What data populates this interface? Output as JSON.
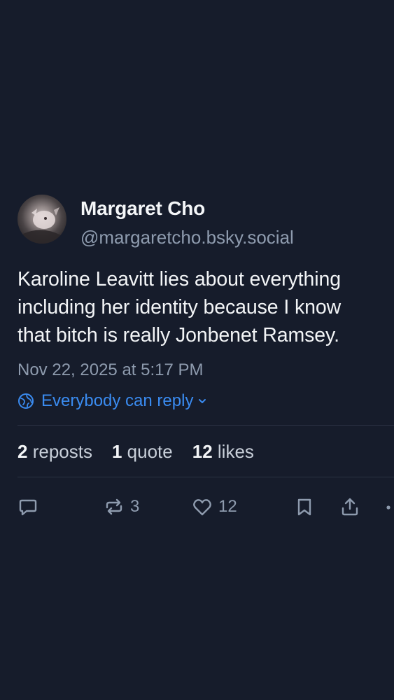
{
  "post": {
    "author": {
      "display_name": "Margaret Cho",
      "handle": "@margaretcho.bsky.social",
      "avatar_icon": "avatar-photo"
    },
    "text_lines": [
      "Karoline Leavitt lies about everything",
      "including her identity because I know",
      "that bitch is really Jonbenet Ramsey."
    ],
    "timestamp": "Nov 22, 2025 at 5:17 PM",
    "reply_setting": {
      "label": "Everybody can reply",
      "icon": "globe-icon",
      "chevron": "chevron-down-icon"
    },
    "stats": {
      "reposts_count": "2",
      "reposts_label": "reposts",
      "quotes_count": "1",
      "quotes_label": "quote",
      "likes_count": "12",
      "likes_label": "likes"
    },
    "actions": {
      "reply_icon": "reply-icon",
      "repost_icon": "repost-icon",
      "repost_count": "3",
      "like_icon": "heart-icon",
      "like_count": "12",
      "bookmark_icon": "bookmark-icon",
      "share_icon": "share-icon",
      "more_icon": "more-icon"
    }
  },
  "colors": {
    "background": "#161c2b",
    "primary_text": "#f2f4f6",
    "secondary_text": "#8e9bae",
    "accent": "#3a8bf0",
    "divider": "#2a3142"
  }
}
